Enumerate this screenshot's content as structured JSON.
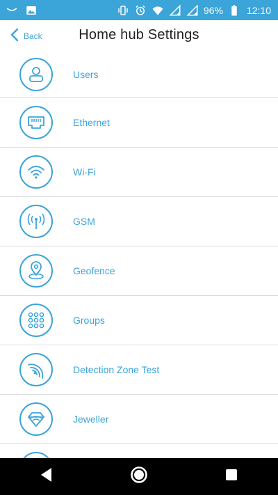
{
  "status_bar": {
    "battery": "96%",
    "time": "12:10",
    "background": "#3ba4d9"
  },
  "header": {
    "back_label": "Back",
    "title": "Home hub Settings"
  },
  "accent_color": "#3ba4d9",
  "items": [
    {
      "label": "Users",
      "icon": "user-icon"
    },
    {
      "label": "Ethernet",
      "icon": "ethernet-icon"
    },
    {
      "label": "Wi-Fi",
      "icon": "wifi-icon"
    },
    {
      "label": "GSM",
      "icon": "gsm-antenna-icon"
    },
    {
      "label": "Geofence",
      "icon": "location-pin-icon"
    },
    {
      "label": "Groups",
      "icon": "grid-dots-icon"
    },
    {
      "label": "Detection Zone Test",
      "icon": "detection-zone-icon"
    },
    {
      "label": "Jeweller",
      "icon": "diamond-icon"
    }
  ],
  "nav": {
    "back": "back-triangle-icon",
    "home": "home-circle-icon",
    "recents": "recents-square-icon"
  }
}
